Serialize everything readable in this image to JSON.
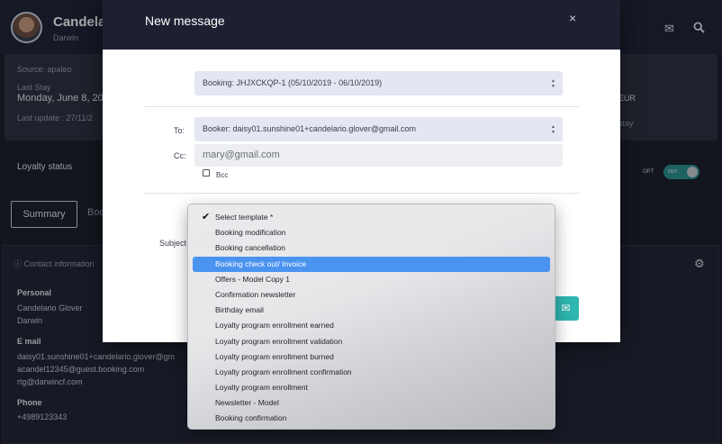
{
  "header": {
    "name": "Candela",
    "subtitle": "Darwin",
    "mail_icon": "envelope-icon",
    "search_icon": "search-icon"
  },
  "info": {
    "source": "Source: apaleo",
    "last_stay_label": "Last Stay",
    "last_stay_value": "Monday, June 8, 20",
    "last_update": "Last update : 27/11/2",
    "eur": "EUR",
    "stay": "stay"
  },
  "loyalty": {
    "label": "Loyalty status",
    "opt": "OPT",
    "toggle_text": "OUT"
  },
  "tabs": {
    "summary": "Summary",
    "bo": "Boo"
  },
  "contact": {
    "title": "Contact information",
    "personal_h": "Personal",
    "personal_name": "Candelario Glover",
    "personal_sub": "Darwin",
    "email_h": "E mail",
    "email_1": "daisy01.sunshine01+candelario.glover@gm",
    "email_2": "acandel12345@guest.booking.com",
    "email_3": "rtg@darwincf.com",
    "phone_h": "Phone",
    "phone_1": "+4989123343"
  },
  "modal": {
    "title": "New message",
    "close": "×",
    "booking_select": "Booking: JHJXCKQP-1 (05/10/2019 - 06/10/2019)",
    "to_label": "To:",
    "to_value": "Booker: daisy01.sunshine01+candelario.glover@gmail.com",
    "cc_label": "Cc:",
    "cc_placeholder": "mary@gmail.com",
    "bcc_label": "Bcc",
    "subject_label": "Subject"
  },
  "template_dropdown": {
    "selected": "Select template *",
    "highlighted_index": 3,
    "options": [
      "Select template *",
      "Booking modification",
      "Booking cancellation",
      "Booking check out/ Invoice",
      "Offers - Model Copy 1",
      "Confirmation newsletter",
      "Birthday email",
      "Loyalty program enrollment earned",
      "Loyalty program enrollment validation",
      "Loyalty program enrollment burned",
      "Loyalty program enrollment confirmation",
      "Loyalty program enrollment",
      "Newsletter - Model",
      "Booking confirmation"
    ]
  },
  "colors": {
    "accent": "#2fb6b0",
    "highlight": "#4a94f0",
    "header_bg": "#1c2030"
  }
}
